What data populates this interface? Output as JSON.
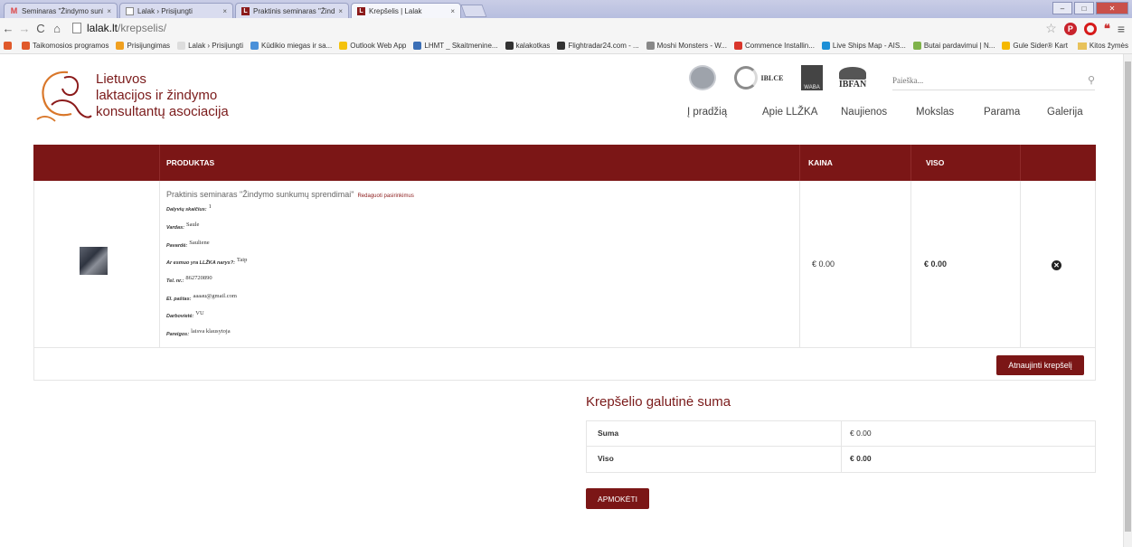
{
  "browser": {
    "tabs": [
      {
        "title": "Seminaras \"Žindymo sunku",
        "icon": "gmail-icon",
        "active": false
      },
      {
        "title": "Lalak › Prisijungti",
        "icon": "page-icon",
        "active": false
      },
      {
        "title": "Praktinis seminaras \"Žind",
        "icon": "lalak-icon",
        "active": false
      },
      {
        "title": "Krepšelis | Lalak",
        "icon": "lalak-icon",
        "active": true
      }
    ],
    "url_host": "lalak.lt",
    "url_path": "/krepselis/",
    "bookmarks": [
      {
        "label": "Taikomosios programos",
        "color": "#e0592a"
      },
      {
        "label": "Prisijungimas",
        "color": "#f0a020"
      },
      {
        "label": "Lalak › Prisijungti",
        "color": "#dddddd"
      },
      {
        "label": "Kūdikio miegas ir sa...",
        "color": "#4a90d9"
      },
      {
        "label": "Outlook Web App",
        "color": "#f4c20d"
      },
      {
        "label": "LHMT _ Skaitmenine...",
        "color": "#3b6fb6"
      },
      {
        "label": "kalakotkas",
        "color": "#333333"
      },
      {
        "label": "Flightradar24.com - ...",
        "color": "#333333"
      },
      {
        "label": "Moshi Monsters - W...",
        "color": "#888888"
      },
      {
        "label": "Commence Installin...",
        "color": "#d9362b"
      },
      {
        "label": "Live Ships Map - AIS...",
        "color": "#1d8fd6"
      },
      {
        "label": "Butai pardavimui | N...",
        "color": "#7fb24a"
      },
      {
        "label": "Gule Sider® Kart",
        "color": "#f5b800"
      }
    ],
    "other_bookmarks": "Kitos žymės"
  },
  "site": {
    "logo_lines": [
      "Lietuvos",
      "laktacijos ir žindymo",
      "konsultantų asociacija"
    ],
    "partners": [
      "IBLCE",
      "WABA",
      "IBFAN"
    ],
    "search_placeholder": "Paieška...",
    "nav": [
      "Į pradžią",
      "Apie LLŽKA",
      "Naujienos",
      "Mokslas",
      "Parama",
      "Galerija"
    ]
  },
  "cart": {
    "headers": {
      "product": "PRODUKTAS",
      "price": "KAINA",
      "total": "VISO"
    },
    "item": {
      "name": "Praktinis seminaras \"Žindymo sunkumų sprendimai\"",
      "edit_link": "Redaguoti pasirinkimus",
      "meta": [
        {
          "key": "Dalyvių skaičius:",
          "value": "1"
        },
        {
          "key": "Vardas:",
          "value": "Saule"
        },
        {
          "key": "Pavardė:",
          "value": "Sauliene"
        },
        {
          "key": "Ar esmuo yra LLŽKA narys?:",
          "value": "Taip"
        },
        {
          "key": "Tel. nr.:",
          "value": "862720890"
        },
        {
          "key": "El. paštas:",
          "value": "aaaau@gmail.com"
        },
        {
          "key": "Darbovietė:",
          "value": "VU"
        },
        {
          "key": "Pareigos:",
          "value": "laisva klausytoja"
        }
      ],
      "price": "€ 0.00",
      "total": "€ 0.00"
    },
    "update_button": "Atnaujinti krepšelį"
  },
  "totals": {
    "title": "Krepšelio galutinė suma",
    "rows": [
      {
        "label": "Suma",
        "value": "€ 0.00"
      },
      {
        "label": "Viso",
        "value": "€ 0.00"
      }
    ],
    "checkout_button": "APMOKĖTI"
  }
}
